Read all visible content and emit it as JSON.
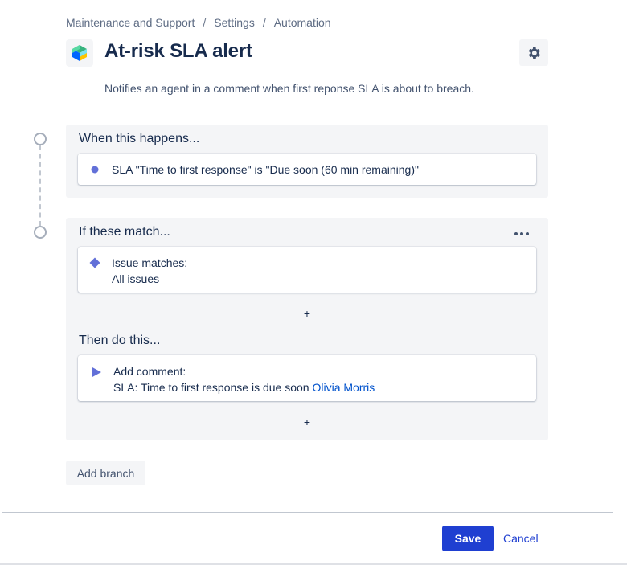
{
  "breadcrumb": [
    "Maintenance and Support",
    "Settings",
    "Automation"
  ],
  "breadcrumb_separator": "/",
  "rule": {
    "title": "At-risk SLA alert",
    "description": "Notifies an agent in a comment when first reponse SLA is about to breach."
  },
  "trigger": {
    "heading": "When this happens...",
    "text": "SLA \"Time to first response\" is \"Due soon (60 min remaining)\"",
    "icon": "dot-icon",
    "color": "#6270d8"
  },
  "condition": {
    "heading": "If these match...",
    "label": "Issue matches:",
    "value": "All issues",
    "icon": "diamond-icon",
    "color": "#6270d8"
  },
  "action": {
    "heading": "Then do this...",
    "label": "Add comment:",
    "text": "SLA: Time to first response is due soon",
    "mention": "Olivia Morris",
    "icon": "play-triangle-icon",
    "color": "#6270d8"
  },
  "add_symbol": "+",
  "add_branch_label": "Add branch",
  "footer": {
    "save_label": "Save",
    "cancel_label": "Cancel"
  },
  "colors": {
    "primary": "#1f3fd1",
    "link": "#0052cc",
    "panel": "#f4f5f7"
  }
}
